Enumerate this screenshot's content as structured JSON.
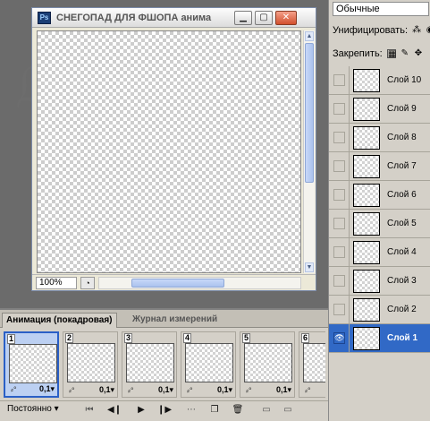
{
  "document": {
    "app_icon": "Ps",
    "title": "СНЕГОПАД ДЛЯ ФШОПА анима",
    "zoom": "100%"
  },
  "layers_panel": {
    "blend_mode": "Обычные",
    "unify_label": "Унифицировать:",
    "lock_label": "Закрепить:",
    "layers": [
      {
        "name": "Слой 10",
        "visible": false,
        "selected": false
      },
      {
        "name": "Слой 9",
        "visible": false,
        "selected": false
      },
      {
        "name": "Слой 8",
        "visible": false,
        "selected": false
      },
      {
        "name": "Слой 7",
        "visible": false,
        "selected": false
      },
      {
        "name": "Слой 6",
        "visible": false,
        "selected": false
      },
      {
        "name": "Слой 5",
        "visible": false,
        "selected": false
      },
      {
        "name": "Слой 4",
        "visible": false,
        "selected": false
      },
      {
        "name": "Слой 3",
        "visible": false,
        "selected": false
      },
      {
        "name": "Слой 2",
        "visible": false,
        "selected": false
      },
      {
        "name": "Слой 1",
        "visible": true,
        "selected": true
      }
    ]
  },
  "animation_panel": {
    "tabs": [
      "Анимация (покадровая)",
      "Журнал измерений"
    ],
    "frames": [
      {
        "num": "1",
        "delay": "0,1▾",
        "selected": true
      },
      {
        "num": "2",
        "delay": "0,1▾",
        "selected": false
      },
      {
        "num": "3",
        "delay": "0,1▾",
        "selected": false
      },
      {
        "num": "4",
        "delay": "0,1▾",
        "selected": false
      },
      {
        "num": "5",
        "delay": "0,1▾",
        "selected": false
      },
      {
        "num": "6",
        "delay": "",
        "selected": false
      }
    ],
    "loop": "Постоянно ▾"
  },
  "colors": {
    "selection": "#3169c6",
    "panel_bg": "#d4d0c8",
    "workspace_bg": "#6b6b6b"
  }
}
